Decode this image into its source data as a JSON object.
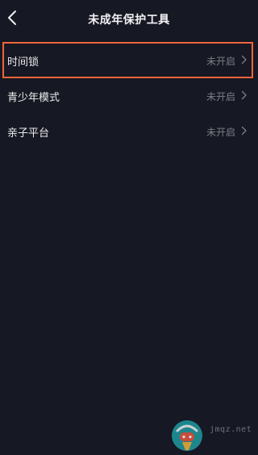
{
  "header": {
    "title": "未成年保护工具",
    "back_icon": "chevron-left-icon"
  },
  "settings": {
    "items": [
      {
        "label": "时间锁",
        "status": "未开启",
        "icon": "chevron-right-icon",
        "highlighted": true
      },
      {
        "label": "青少年模式",
        "status": "未开启",
        "icon": "chevron-right-icon",
        "highlighted": false
      },
      {
        "label": "亲子平台",
        "status": "未开启",
        "icon": "chevron-right-icon",
        "highlighted": false
      }
    ]
  },
  "watermark": {
    "logo_icon": "gamepad-mascot-icon",
    "text": "jmqz.net"
  },
  "colors": {
    "background": "#161823",
    "highlight_border": "#f0643a",
    "status_text": "#7c7e86"
  }
}
